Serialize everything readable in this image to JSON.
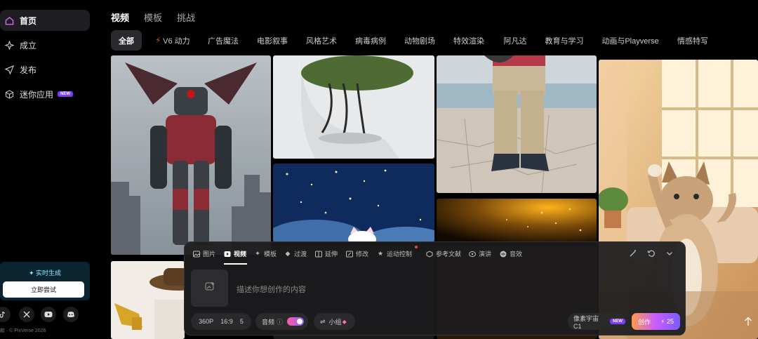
{
  "sidebar": {
    "items": [
      {
        "label": "首页",
        "icon": "home-icon",
        "active": true
      },
      {
        "label": "成立",
        "icon": "sparkle-icon"
      },
      {
        "label": "发布",
        "icon": "send-icon"
      },
      {
        "label": "迷你应用",
        "icon": "cube-icon",
        "badge": "NEW"
      }
    ],
    "promo": {
      "title": "实时生成",
      "button": "立即尝试"
    },
    "social": [
      "tiktok-icon",
      "x-icon",
      "youtube-icon",
      "discord-icon"
    ],
    "footer": "款 · © PixVerse 2026"
  },
  "top_tabs": [
    {
      "label": "视频",
      "active": true
    },
    {
      "label": "模板"
    },
    {
      "label": "挑战"
    }
  ],
  "filters": [
    {
      "label": "全部",
      "active": true
    },
    {
      "label": "V6 动力",
      "icon": "bolt-icon"
    },
    {
      "label": "广告魔法"
    },
    {
      "label": "电影叙事"
    },
    {
      "label": "风格艺术"
    },
    {
      "label": "病毒病例"
    },
    {
      "label": "动物剧场"
    },
    {
      "label": "特效渲染"
    },
    {
      "label": "阿凡达"
    },
    {
      "label": "教育与学习"
    },
    {
      "label": "动画与Playverse"
    },
    {
      "label": "情感特写"
    }
  ],
  "composer": {
    "tabs": [
      {
        "label": "图片",
        "icon": "image-icon"
      },
      {
        "label": "视频",
        "icon": "video-icon",
        "active": true
      },
      {
        "label": "模板",
        "icon": "template-icon"
      },
      {
        "label": "过渡",
        "icon": "transition-icon"
      },
      {
        "label": "延伸",
        "icon": "extend-icon"
      },
      {
        "label": "修改",
        "icon": "edit-icon"
      },
      {
        "label": "运动控制",
        "icon": "motion-icon"
      },
      {
        "label": "参考文献",
        "icon": "reference-icon"
      },
      {
        "label": "演讲",
        "icon": "speech-icon"
      },
      {
        "label": "音效",
        "icon": "sound-icon"
      }
    ],
    "placeholder": "描述你想创作的内容",
    "settings": {
      "resolution": "360P",
      "ratio": "16:9",
      "duration": "5"
    },
    "audio_label": "音频",
    "audio_on": true,
    "mini_label": "小组",
    "model": "像素宇宙C1",
    "model_badge": "NEW",
    "create_label": "创作",
    "credits": "25"
  },
  "colors": {
    "accent": "#8a5cff",
    "promo_text": "#8fe7ff",
    "create_start": "#ff9a4a"
  }
}
